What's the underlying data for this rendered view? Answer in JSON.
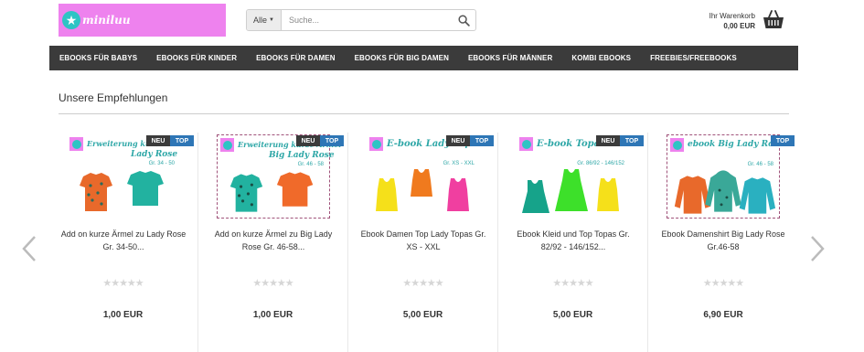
{
  "brand": {
    "name": "miniluu",
    "color": "#ee82ee"
  },
  "search": {
    "category": "Alle",
    "placeholder": "Suche..."
  },
  "cart": {
    "label": "Ihr Warenkorb",
    "total": "0,00 EUR"
  },
  "nav": [
    "EBOOKS FÜR BABYS",
    "EBOOKS FÜR KINDER",
    "EBOOKS FÜR DAMEN",
    "EBOOKS FÜR BIG DAMEN",
    "EBOOKS FÜR MÄNNER",
    "KOMBI EBOOKS",
    "FREEBIES/FREEBOOKS"
  ],
  "section_title": "Unsere Empfehlungen",
  "products": [
    {
      "thumb_title": "Erweiterung kurze Ärmel",
      "thumb_title2": "Lady Rose",
      "thumb_sub": "Gr. 34 - 50",
      "badges": [
        "NEU",
        "TOP"
      ],
      "name": "Add on kurze Ärmel zu Lady Rose Gr. 34-50...",
      "rating": "★★★★★",
      "price": "1,00 EUR"
    },
    {
      "thumb_title": "Erweiterung kurze Ärmel",
      "thumb_title2": "Big Lady Rose",
      "thumb_sub": "Gr. 46 - 58",
      "badges": [
        "NEU",
        "TOP"
      ],
      "name": "Add on kurze Ärmel zu Big Lady Rose Gr. 46-58...",
      "rating": "★★★★★",
      "price": "1,00 EUR"
    },
    {
      "thumb_title": "E-book Lady Topas",
      "thumb_title2": "",
      "thumb_sub": "Gr. XS - XXL",
      "badges": [
        "NEU",
        "TOP"
      ],
      "name": "Ebook Damen Top Lady Topas Gr. XS - XXL",
      "rating": "★★★★★",
      "price": "5,00 EUR"
    },
    {
      "thumb_title": "E-book Topas",
      "thumb_title2": "",
      "thumb_sub": "Gr. 86/92 - 146/152",
      "badges": [
        "NEU",
        "TOP"
      ],
      "name": "Ebook Kleid und Top Topas Gr. 82/92 - 146/152...",
      "rating": "★★★★★",
      "price": "5,00 EUR"
    },
    {
      "thumb_title": "ebook Big Lady Rose",
      "thumb_title2": "",
      "thumb_sub": "Gr. 46 - 58",
      "badges": [
        "TOP"
      ],
      "name": "Ebook Damenshirt Big Lady Rose Gr.46-58",
      "rating": "★★★★★",
      "price": "6,90 EUR"
    }
  ]
}
